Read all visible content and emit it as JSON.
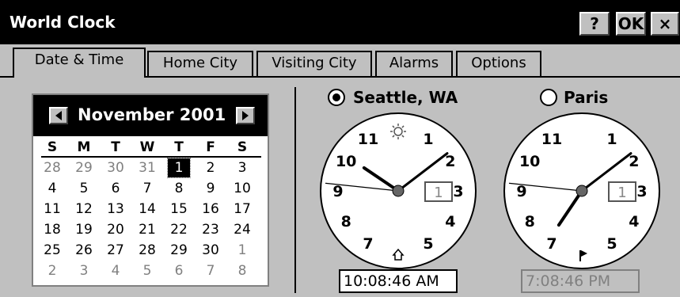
{
  "window": {
    "title": "World Clock",
    "help_label": "?",
    "ok_label": "OK",
    "close_label": "×"
  },
  "tabs": [
    {
      "label": "Date & Time",
      "active": true
    },
    {
      "label": "Home City"
    },
    {
      "label": "Visiting City"
    },
    {
      "label": "Alarms"
    },
    {
      "label": "Options"
    }
  ],
  "calendar": {
    "month_label": "November 2001",
    "weekdays": [
      "S",
      "M",
      "T",
      "W",
      "T",
      "F",
      "S"
    ],
    "weeks": [
      [
        "28",
        "29",
        "30",
        "31",
        "1",
        "2",
        "3"
      ],
      [
        "4",
        "5",
        "6",
        "7",
        "8",
        "9",
        "10"
      ],
      [
        "11",
        "12",
        "13",
        "14",
        "15",
        "16",
        "17"
      ],
      [
        "18",
        "19",
        "20",
        "21",
        "22",
        "23",
        "24"
      ],
      [
        "25",
        "26",
        "27",
        "28",
        "29",
        "30",
        "1"
      ],
      [
        "2",
        "3",
        "4",
        "5",
        "6",
        "7",
        "8"
      ]
    ],
    "selected_day": "1"
  },
  "home_clock": {
    "city": "Seattle, WA",
    "selected": true,
    "time": "10:08:46 AM",
    "date_box": "1",
    "day_icon": "sun-icon",
    "marker_icon": "home-icon"
  },
  "visiting_clock": {
    "city": "Paris",
    "selected": false,
    "time": "7:08:46 PM",
    "date_box": "1",
    "day_icon": "moon-icon",
    "marker_icon": "flag-icon"
  },
  "clock_numbers": [
    "1",
    "2",
    "3",
    "4",
    "5",
    "7",
    "8",
    "9",
    "10",
    "11"
  ]
}
